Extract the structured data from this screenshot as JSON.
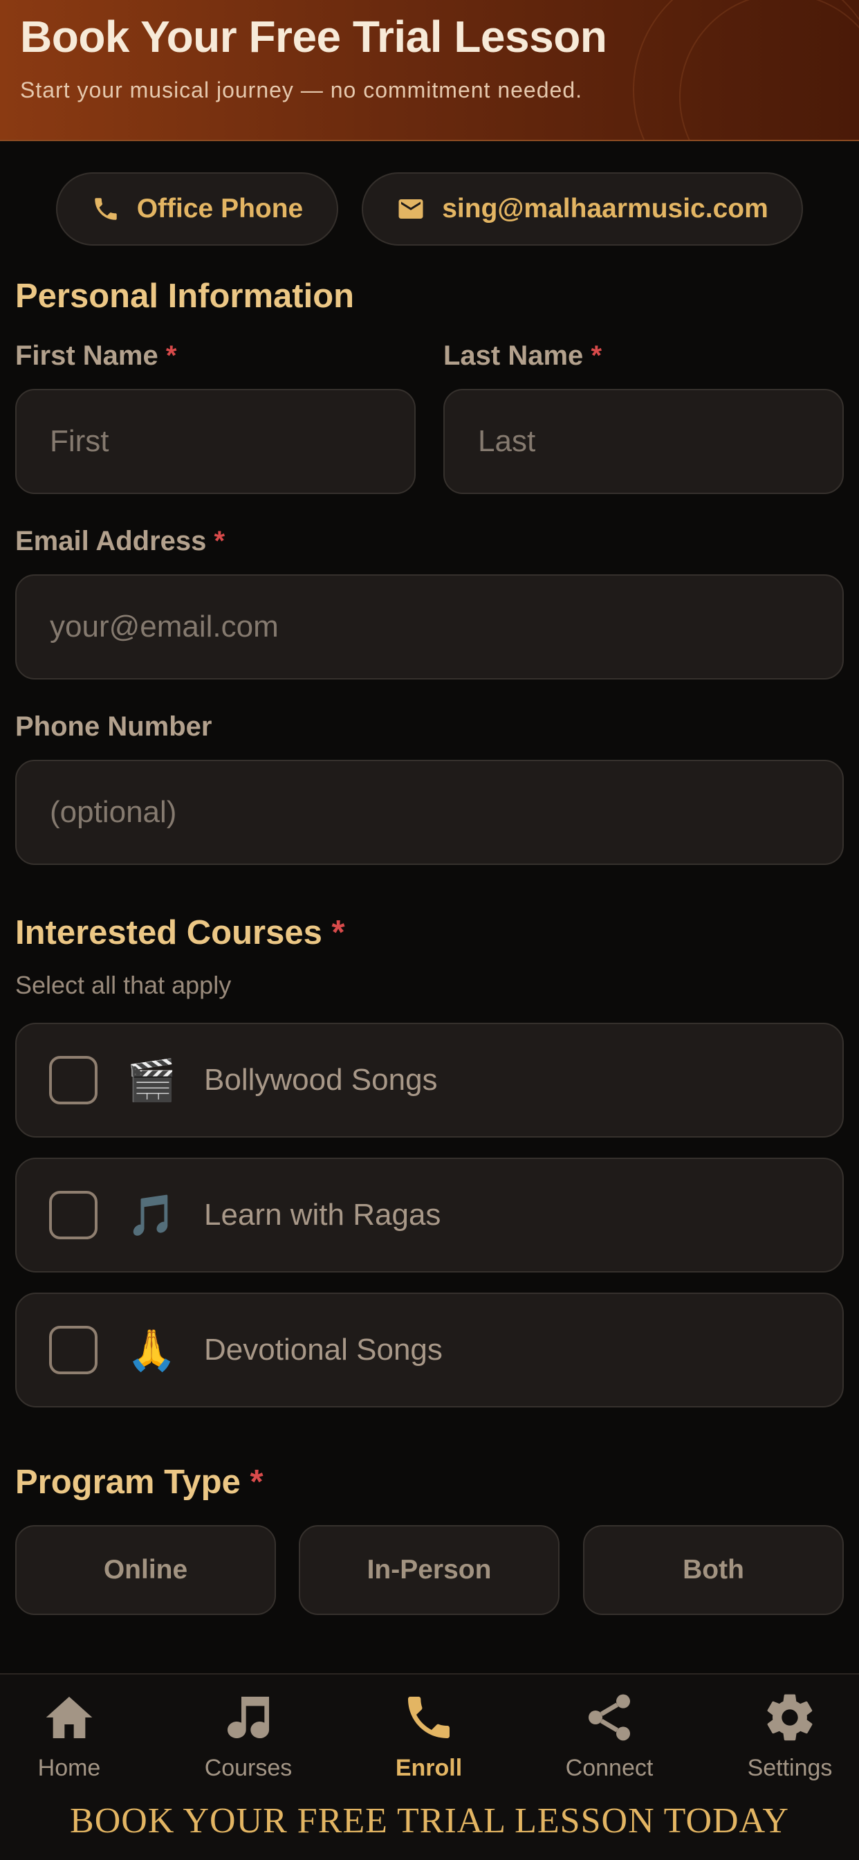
{
  "header": {
    "title": "Book Your Free Trial Lesson",
    "subtitle": "Start your musical journey — no commitment needed."
  },
  "contact": {
    "phone_label": "Office Phone",
    "email_label": "sing@malhaarmusic.com"
  },
  "personal": {
    "title": "Personal Information",
    "first_name_label": "First Name",
    "first_name_placeholder": "First",
    "last_name_label": "Last Name",
    "last_name_placeholder": "Last",
    "email_label": "Email Address",
    "email_placeholder": "your@email.com",
    "phone_label": "Phone Number",
    "phone_placeholder": "(optional)",
    "required_mark": "*"
  },
  "courses": {
    "title": "Interested Courses",
    "hint": "Select all that apply",
    "items": [
      {
        "emoji": "🎬",
        "label": "Bollywood Songs"
      },
      {
        "emoji": "🎵",
        "label": "Learn with Ragas"
      },
      {
        "emoji": "🙏",
        "label": "Devotional Songs"
      }
    ]
  },
  "program": {
    "title": "Program Type",
    "options": [
      "Online",
      "In-Person",
      "Both"
    ]
  },
  "nav": {
    "items": [
      {
        "label": "Home",
        "icon": "home-icon"
      },
      {
        "label": "Courses",
        "icon": "music-note-icon"
      },
      {
        "label": "Enroll",
        "icon": "phone-icon",
        "active": true
      },
      {
        "label": "Connect",
        "icon": "share-icon"
      },
      {
        "label": "Settings",
        "icon": "gear-icon"
      }
    ],
    "banner": "BOOK YOUR FREE TRIAL LESSON TODAY"
  },
  "colors": {
    "accent": "#e3b563",
    "background": "#0b0a09",
    "required": "#d94b4b"
  }
}
